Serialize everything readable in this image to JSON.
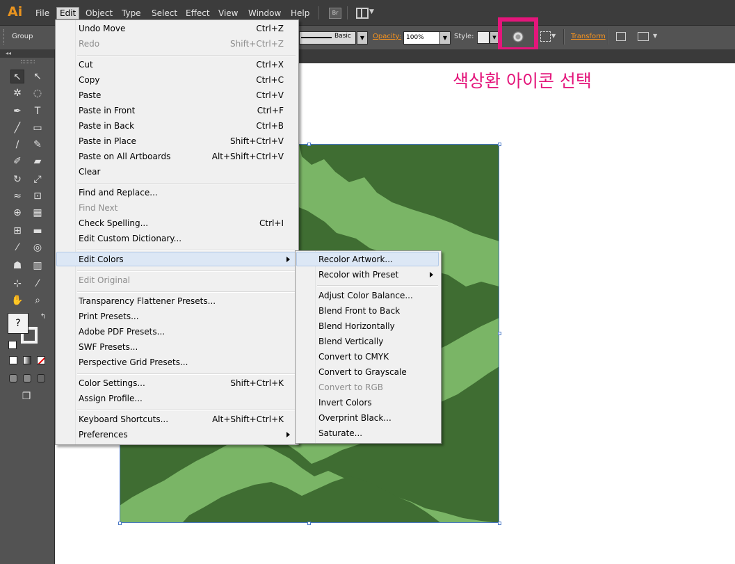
{
  "app": {
    "logo": "Ai"
  },
  "menubar": {
    "items": [
      "File",
      "Edit",
      "Object",
      "Type",
      "Select",
      "Effect",
      "View",
      "Window",
      "Help"
    ],
    "bridge": "Br"
  },
  "control_bar": {
    "selection": "Group",
    "stroke_profile": "Basic",
    "opacity_label": "Opacity:",
    "opacity_value": "100%",
    "style_label": "Style:",
    "transform_label": "Transform"
  },
  "annotation": {
    "text": "색상환 아이콘 선택",
    "color": "#e4167b"
  },
  "edit_menu": {
    "items": [
      {
        "label": "Undo Move",
        "shortcut": "Ctrl+Z"
      },
      {
        "label": "Redo",
        "shortcut": "Shift+Ctrl+Z",
        "disabled": true
      },
      {
        "label": "Cut",
        "shortcut": "Ctrl+X"
      },
      {
        "label": "Copy",
        "shortcut": "Ctrl+C"
      },
      {
        "label": "Paste",
        "shortcut": "Ctrl+V"
      },
      {
        "label": "Paste in Front",
        "shortcut": "Ctrl+F"
      },
      {
        "label": "Paste in Back",
        "shortcut": "Ctrl+B"
      },
      {
        "label": "Paste in Place",
        "shortcut": "Shift+Ctrl+V"
      },
      {
        "label": "Paste on All Artboards",
        "shortcut": "Alt+Shift+Ctrl+V"
      },
      {
        "label": "Clear",
        "shortcut": ""
      },
      {
        "label": "Find and Replace...",
        "shortcut": ""
      },
      {
        "label": "Find Next",
        "shortcut": "",
        "disabled": true
      },
      {
        "label": "Check Spelling...",
        "shortcut": "Ctrl+I"
      },
      {
        "label": "Edit Custom Dictionary...",
        "shortcut": ""
      },
      {
        "label": "Edit Colors",
        "shortcut": "",
        "submenu": true
      },
      {
        "label": "Edit Original",
        "shortcut": "",
        "disabled": true
      },
      {
        "label": "Transparency Flattener Presets...",
        "shortcut": ""
      },
      {
        "label": "Print Presets...",
        "shortcut": ""
      },
      {
        "label": "Adobe PDF Presets...",
        "shortcut": ""
      },
      {
        "label": "SWF Presets...",
        "shortcut": ""
      },
      {
        "label": "Perspective Grid Presets...",
        "shortcut": ""
      },
      {
        "label": "Color Settings...",
        "shortcut": "Shift+Ctrl+K"
      },
      {
        "label": "Assign Profile...",
        "shortcut": ""
      },
      {
        "label": "Keyboard Shortcuts...",
        "shortcut": "Alt+Shift+Ctrl+K"
      },
      {
        "label": "Preferences",
        "shortcut": "",
        "submenu": true
      }
    ]
  },
  "edit_colors_submenu": {
    "items": [
      {
        "label": "Recolor Artwork..."
      },
      {
        "label": "Recolor with Preset",
        "submenu": true
      },
      {
        "label": "Adjust Color Balance..."
      },
      {
        "label": "Blend Front to Back"
      },
      {
        "label": "Blend Horizontally"
      },
      {
        "label": "Blend Vertically"
      },
      {
        "label": "Convert to CMYK"
      },
      {
        "label": "Convert to Grayscale"
      },
      {
        "label": "Convert to RGB",
        "disabled": true
      },
      {
        "label": "Invert Colors"
      },
      {
        "label": "Overprint Black..."
      },
      {
        "label": "Saturate..."
      }
    ]
  },
  "colors": {
    "dark_green": "#3f6d32",
    "light_green": "#7ab566",
    "accent": "#f7931e",
    "highlight": "#e4167b"
  }
}
